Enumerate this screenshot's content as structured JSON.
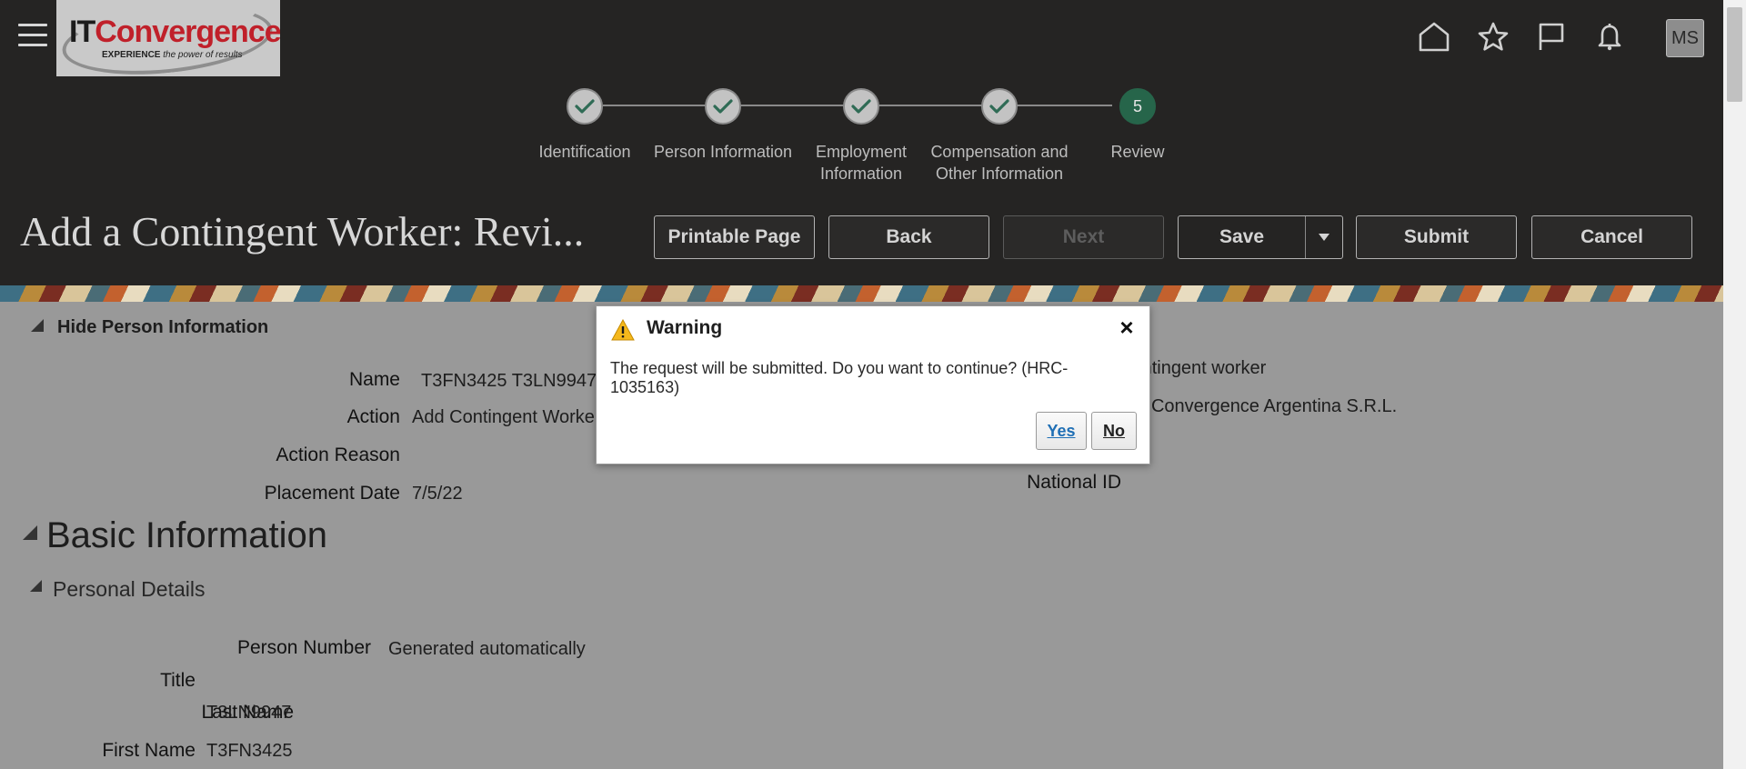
{
  "header": {
    "menu_icon": "hamburger-menu-icon",
    "logo": {
      "brand_it": "IT",
      "brand_rest": "Convergence",
      "tagline_bold": "EXPERIENCE",
      "tagline_rest": " the power of results"
    },
    "icons": [
      "home-icon",
      "star-icon",
      "flag-icon",
      "bell-icon"
    ],
    "avatar_initials": "MS"
  },
  "train": {
    "stops": [
      {
        "label": "Identification",
        "state": "complete"
      },
      {
        "label": "Person Information",
        "state": "complete"
      },
      {
        "label": "Employment Information",
        "state": "complete"
      },
      {
        "label": "Compensation and Other Information",
        "state": "complete"
      },
      {
        "label": "Review",
        "state": "current",
        "number": "5"
      }
    ]
  },
  "page": {
    "title": "Add a Contingent Worker: Revi...",
    "buttons": {
      "printable": "Printable Page",
      "back": "Back",
      "next": "Next",
      "save": "Save",
      "submit": "Submit",
      "cancel": "Cancel"
    }
  },
  "person": {
    "hide_link": "Hide Person Information",
    "fields": {
      "name_label": "Name",
      "name_value": "T3FN3425 T3LN9947",
      "action_label": "Action",
      "action_value": "Add Contingent Worker",
      "action_reason_label": "Action Reason",
      "placement_date_label": "Placement Date",
      "placement_date_value": "7/5/22",
      "worker_type_value": "Contingent worker",
      "legal_employer_value": "IT Convergence Argentina S.R.L.",
      "national_id_label": "National ID"
    }
  },
  "basic_information": {
    "heading": "Basic Information",
    "personal_details": {
      "heading": "Personal Details",
      "person_number_label": "Person Number",
      "person_number_value": "Generated automatically",
      "title_label": "Title",
      "last_name_label": "Last Name",
      "last_name_value": "T3LN9947",
      "first_name_label": "First Name",
      "first_name_value": "T3FN3425"
    }
  },
  "dialog": {
    "title": "Warning",
    "message": "The request will be submitted. Do you want to continue? (HRC-1035163)",
    "yes": "Yes",
    "no": "No",
    "icon": "warning-icon"
  },
  "colors": {
    "header_bg": "#252423",
    "train_current": "#26654a",
    "check": "#2f6b55",
    "link_blue": "#1f6fb5",
    "warning_yellow": "#f5b81c"
  }
}
